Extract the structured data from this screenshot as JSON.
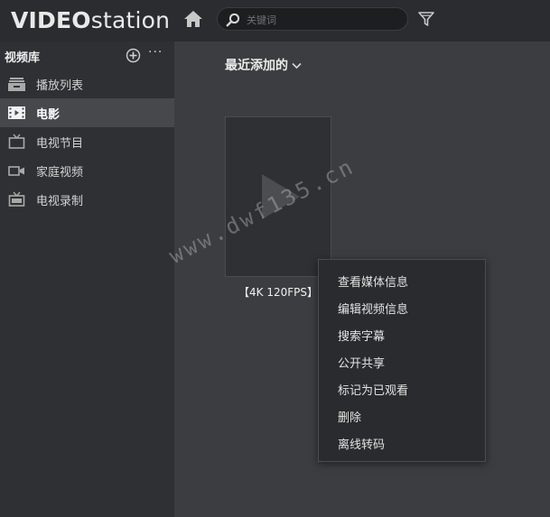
{
  "app": {
    "logo_bold": "VIDEO",
    "logo_light": "station",
    "home_icon": "home-icon",
    "filter_icon": "filter-icon"
  },
  "search": {
    "placeholder": "关键词",
    "value": ""
  },
  "sidebar": {
    "title": "视频库",
    "add_icon": "plus-circle-icon",
    "more_label": "···",
    "items": [
      {
        "label": "播放列表",
        "icon": "playlist-icon",
        "active": false
      },
      {
        "label": "电影",
        "icon": "film-icon",
        "active": true
      },
      {
        "label": "电视节目",
        "icon": "tv-icon",
        "active": false
      },
      {
        "label": "家庭视频",
        "icon": "camcorder-icon",
        "active": false
      },
      {
        "label": "电视录制",
        "icon": "tv-record-icon",
        "active": false
      }
    ]
  },
  "content": {
    "header": "最近添加的",
    "videos": [
      {
        "title": "【4K 120FPS】"
      }
    ]
  },
  "context_menu": {
    "items": [
      "查看媒体信息",
      "编辑视频信息",
      "搜索字幕",
      "公开共享",
      "标记为已观看",
      "删除",
      "离线转码"
    ]
  },
  "watermark": "www.dwf135.cn",
  "colors": {
    "topbar": "#2b2c2f",
    "sidebar": "#2e3033",
    "sidebar_active": "#46484c",
    "content_bg": "#3b3d40",
    "menu_bg": "#2a2b2e",
    "logo_dot_accent": "#d9232d"
  }
}
